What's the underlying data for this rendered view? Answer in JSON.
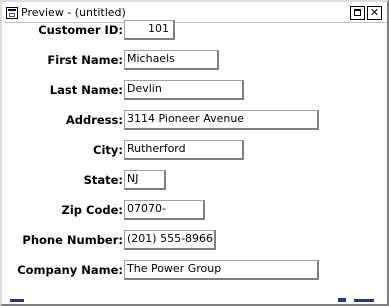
{
  "window": {
    "title": "Preview - (untitled)",
    "maximize_glyph": "",
    "close_glyph": "✕"
  },
  "form": {
    "fields": [
      {
        "label": "Customer ID:",
        "value": "101"
      },
      {
        "label": "First Name:",
        "value": "Michaels"
      },
      {
        "label": "Last Name:",
        "value": "Devlin"
      },
      {
        "label": "Address:",
        "value": "3114 Pioneer Avenue"
      },
      {
        "label": "City:",
        "value": "Rutherford"
      },
      {
        "label": "State:",
        "value": "NJ"
      },
      {
        "label": "Zip Code:",
        "value": "07070-"
      },
      {
        "label": "Phone Number:",
        "value": "(201) 555-8966"
      },
      {
        "label": "Company Name:",
        "value": "The Power Group"
      }
    ]
  }
}
